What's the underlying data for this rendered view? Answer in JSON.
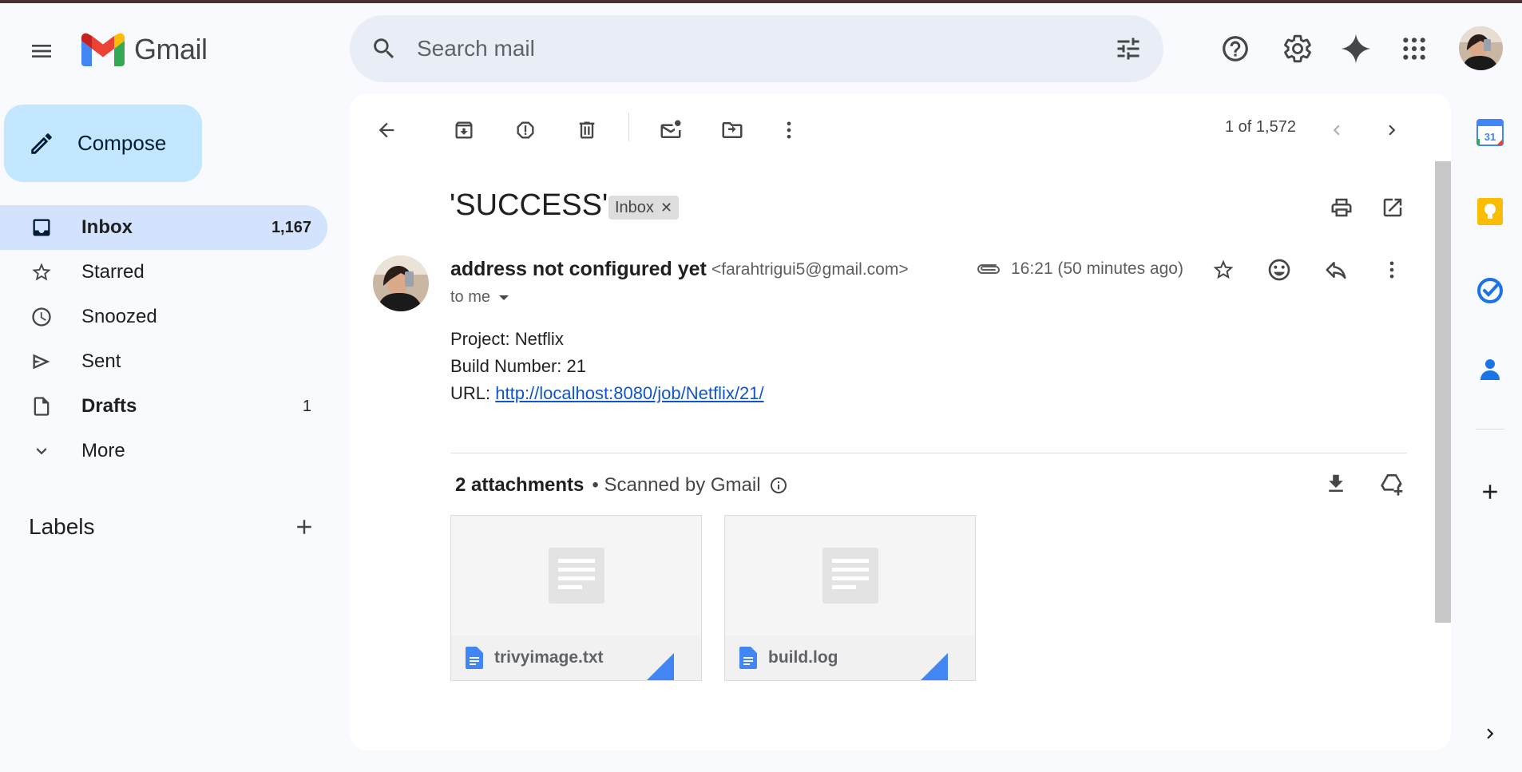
{
  "app": {
    "name": "Gmail"
  },
  "search": {
    "placeholder": "Search mail"
  },
  "compose": {
    "label": "Compose"
  },
  "nav": [
    {
      "id": "inbox",
      "label": "Inbox",
      "count": "1,167",
      "active": true
    },
    {
      "id": "starred",
      "label": "Starred",
      "count": ""
    },
    {
      "id": "snoozed",
      "label": "Snoozed",
      "count": ""
    },
    {
      "id": "sent",
      "label": "Sent",
      "count": ""
    },
    {
      "id": "drafts",
      "label": "Drafts",
      "count": "1"
    },
    {
      "id": "more",
      "label": "More",
      "count": ""
    }
  ],
  "labels": {
    "title": "Labels"
  },
  "toolbar": {
    "pager": "1 of 1,572"
  },
  "email": {
    "subject": "'SUCCESS'",
    "label_chip": "Inbox",
    "sender_name": "address not configured yet",
    "sender_email": "<farahtrigui5@gmail.com>",
    "to": "to me",
    "time": "16:21 (50 minutes ago)",
    "body": {
      "project": "Project: Netflix",
      "build": "Build Number: 21",
      "url_label": "URL: ",
      "url": "http://localhost:8080/job/Netflix/21/"
    },
    "attachments_count": "2 attachments",
    "scanned": "• Scanned by Gmail",
    "attachments": [
      {
        "name": "trivyimage.txt"
      },
      {
        "name": "build.log"
      }
    ]
  },
  "colors": {
    "accent": "#0b57d0",
    "compose_bg": "#c2e7ff",
    "active_nav": "#d3e3fd",
    "link": "#1155cc",
    "doc_icon": "#4285f4"
  }
}
